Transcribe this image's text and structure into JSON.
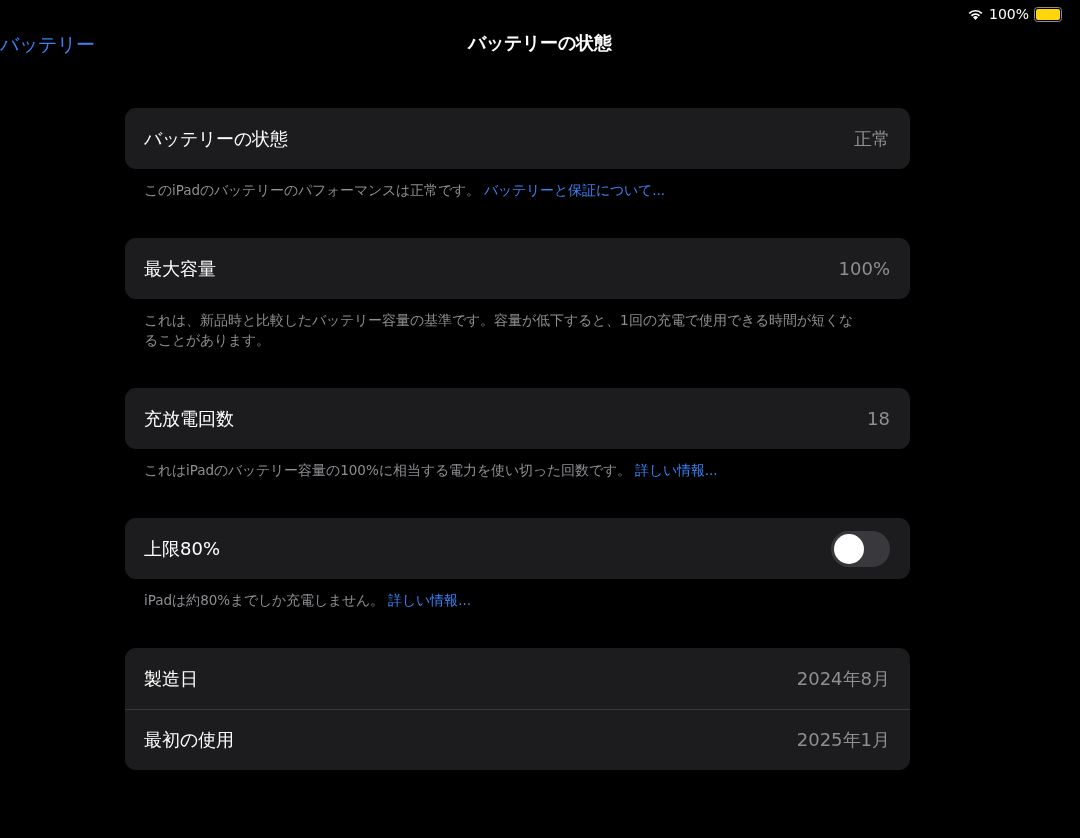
{
  "status_bar": {
    "battery_text": "100%"
  },
  "nav": {
    "back": "バッテリー",
    "title": "バッテリーの状態"
  },
  "sections": [
    {
      "rows": [
        {
          "kind": "value",
          "label": "バッテリーの状態",
          "value": "正常"
        }
      ],
      "footer": {
        "text": "このiPadのバッテリーのパフォーマンスは正常です。",
        "link": "バッテリーと保証について..."
      }
    },
    {
      "rows": [
        {
          "kind": "value",
          "label": "最大容量",
          "value": "100%"
        }
      ],
      "footer": {
        "text": "これは、新品時と比較したバッテリー容量の基準です。容量が低下すると、1回の充電で使用できる時間が短くなることがあります。"
      }
    },
    {
      "rows": [
        {
          "kind": "value",
          "label": "充放電回数",
          "value": "18"
        }
      ],
      "footer": {
        "text": "これはiPadのバッテリー容量の100%に相当する電力を使い切った回数です。",
        "link": "詳しい情報..."
      }
    },
    {
      "rows": [
        {
          "kind": "toggle",
          "label": "上限80%",
          "on": false
        }
      ],
      "footer": {
        "text": "iPadは約80%までしか充電しません。",
        "link": "詳しい情報..."
      }
    },
    {
      "rows": [
        {
          "kind": "value",
          "label": "製造日",
          "value": "2024年8月"
        },
        {
          "kind": "value",
          "label": "最初の使用",
          "value": "2025年1月"
        }
      ]
    }
  ]
}
